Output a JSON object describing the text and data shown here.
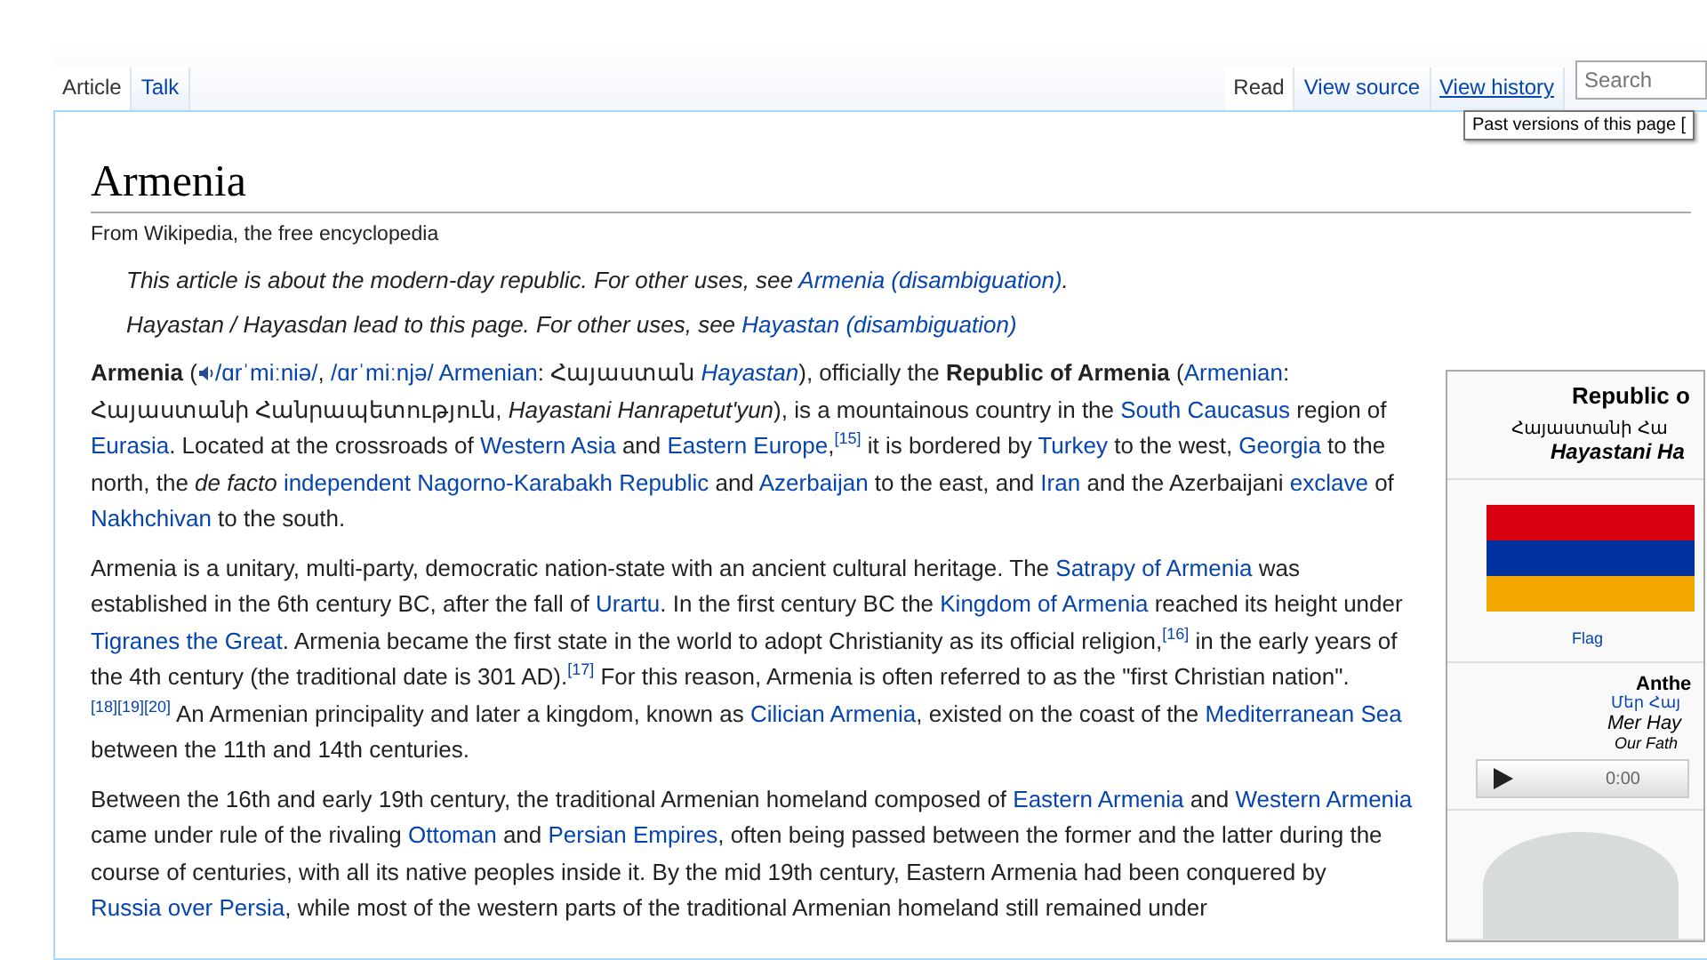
{
  "tabs_left": [
    {
      "label": "Article",
      "selected": true
    },
    {
      "label": "Talk",
      "selected": false
    }
  ],
  "tabs_right": [
    {
      "label": "Read",
      "selected": true,
      "hovered": false
    },
    {
      "label": "View source",
      "selected": false,
      "hovered": false
    },
    {
      "label": "View history",
      "selected": false,
      "hovered": true
    }
  ],
  "search": {
    "placeholder": "Search"
  },
  "tooltip": "Past versions of this page [",
  "title": "Armenia",
  "tagline": "From Wikipedia, the free encyclopedia",
  "hatnotes": [
    [
      {
        "kind": "text",
        "t": "This article is about the modern-day republic. For other uses, see "
      },
      {
        "kind": "link",
        "t": "Armenia (disambiguation)"
      },
      {
        "kind": "text",
        "t": "."
      }
    ],
    [
      {
        "kind": "text",
        "t": "Hayastan / Hayasdan lead to this page. For other uses, see "
      },
      {
        "kind": "link",
        "t": "Hayastan (disambiguation)"
      }
    ]
  ],
  "paragraphs": [
    [
      {
        "kind": "text",
        "t": "**Armenia** ("
      },
      {
        "kind": "audio",
        "t": "/ɑrˈmiːniə/"
      },
      {
        "kind": "text",
        "t": ", "
      },
      {
        "kind": "link",
        "t": "/ɑrˈmiːnjə/"
      },
      {
        "kind": "link",
        "t": " Armenian"
      },
      {
        "kind": "text",
        "t": ": Հայաստան "
      },
      {
        "kind": "link",
        "t": "*Hayastan*"
      },
      {
        "kind": "text",
        "t": "), officially the **Republic of Armenia** ("
      },
      {
        "kind": "link",
        "t": "Armenian"
      },
      {
        "kind": "text",
        "t": ": Հայաստանի Հանրապետություն, *Hayastani Hanrapetut'yun*), is a mountainous country in the "
      },
      {
        "kind": "link",
        "t": "South Caucasus"
      },
      {
        "kind": "text",
        "t": " region of "
      },
      {
        "kind": "link",
        "t": "Eurasia"
      },
      {
        "kind": "text",
        "t": ". Located at the crossroads of "
      },
      {
        "kind": "link",
        "t": "Western Asia"
      },
      {
        "kind": "text",
        "t": " and "
      },
      {
        "kind": "link",
        "t": "Eastern Europe"
      },
      {
        "kind": "text",
        "t": ","
      },
      {
        "kind": "ref",
        "t": "[15]"
      },
      {
        "kind": "text",
        "t": " it is bordered by "
      },
      {
        "kind": "link",
        "t": "Turkey"
      },
      {
        "kind": "text",
        "t": " to the west, "
      },
      {
        "kind": "link",
        "t": "Georgia"
      },
      {
        "kind": "text",
        "t": " to the north, the *de facto* "
      },
      {
        "kind": "link",
        "t": "independent"
      },
      {
        "kind": "link",
        "t": " Nagorno-Karabakh Republic"
      },
      {
        "kind": "text",
        "t": " and "
      },
      {
        "kind": "link",
        "t": "Azerbaijan"
      },
      {
        "kind": "text",
        "t": " to the east, and "
      },
      {
        "kind": "link",
        "t": "Iran"
      },
      {
        "kind": "text",
        "t": " and the Azerbaijani "
      },
      {
        "kind": "link",
        "t": "exclave"
      },
      {
        "kind": "text",
        "t": " of "
      },
      {
        "kind": "link",
        "t": "Nakhchivan"
      },
      {
        "kind": "text",
        "t": " to the south."
      }
    ],
    [
      {
        "kind": "text",
        "t": "Armenia is a unitary, multi-party, democratic nation-state with an ancient cultural heritage. The "
      },
      {
        "kind": "link",
        "t": "Satrapy of Armenia"
      },
      {
        "kind": "text",
        "t": " was established in the 6th century BC, after the fall of "
      },
      {
        "kind": "link",
        "t": "Urartu"
      },
      {
        "kind": "text",
        "t": ". In the first century BC the "
      },
      {
        "kind": "link",
        "t": "Kingdom of Armenia"
      },
      {
        "kind": "text",
        "t": " reached its height under "
      },
      {
        "kind": "link",
        "t": "Tigranes the Great"
      },
      {
        "kind": "text",
        "t": ". Armenia became the first state in the world to adopt Christianity as its official religion,"
      },
      {
        "kind": "ref",
        "t": "[16]"
      },
      {
        "kind": "text",
        "t": " in the early years of the 4th century (the traditional date is 301 AD)."
      },
      {
        "kind": "ref",
        "t": "[17]"
      },
      {
        "kind": "text",
        "t": " For this reason, Armenia is often referred to as the \"first Christian nation\"."
      },
      {
        "kind": "ref",
        "t": "[18][19][20]"
      },
      {
        "kind": "text",
        "t": " An Armenian principality and later a kingdom, known as "
      },
      {
        "kind": "link",
        "t": "Cilician Armenia"
      },
      {
        "kind": "text",
        "t": ", existed on the coast of the "
      },
      {
        "kind": "link",
        "t": "Mediterranean Sea"
      },
      {
        "kind": "text",
        "t": " between the 11th and 14th centuries."
      }
    ],
    [
      {
        "kind": "text",
        "t": "Between the 16th and early 19th century, the traditional Armenian homeland composed of "
      },
      {
        "kind": "link",
        "t": "Eastern Armenia"
      },
      {
        "kind": "text",
        "t": " and "
      },
      {
        "kind": "link",
        "t": "Western Armenia"
      },
      {
        "kind": "text",
        "t": " came under rule of the rivaling "
      },
      {
        "kind": "link",
        "t": "Ottoman"
      },
      {
        "kind": "text",
        "t": " and "
      },
      {
        "kind": "link",
        "t": "Persian Empires"
      },
      {
        "kind": "text",
        "t": ", often being passed between the former and the latter during the course of centuries, with all its native peoples inside it. By the mid 19th century, Eastern Armenia had been conquered by "
      },
      {
        "kind": "link",
        "t": "Russia over Persia"
      },
      {
        "kind": "text",
        "t": ", while most of the western parts of the traditional Armenian homeland still remained under"
      }
    ]
  ],
  "infobox": {
    "title": "Republic o",
    "native_name": "Հայաստանի Հա",
    "romanized": "Hayastani Ha",
    "flag_caption": "Flag",
    "anthem_heading": "Anthe",
    "anthem_native": "Մեր Հայ",
    "anthem_romanized": "Mer Hay",
    "anthem_translation": "Our Fath",
    "player_time": "0:00"
  }
}
